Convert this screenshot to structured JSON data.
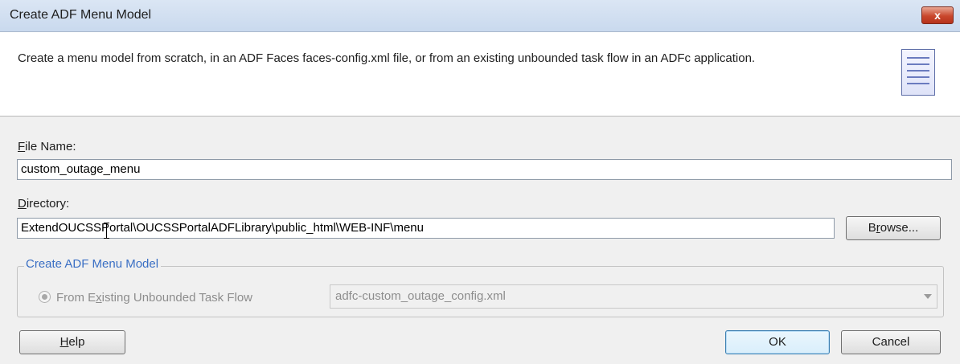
{
  "window": {
    "title": "Create ADF Menu Model",
    "close_glyph": "x"
  },
  "header": {
    "description": "Create a menu model from scratch, in an ADF Faces faces-config.xml file, or from an existing unbounded task flow in an ADFc application.",
    "icon": "document-icon"
  },
  "file_name": {
    "label_mnemonic": "F",
    "label_rest": "ile Name:",
    "value": "custom_outage_menu"
  },
  "directory": {
    "label_mnemonic": "D",
    "label_rest": "irectory:",
    "value": "ExtendOUCSSPortal\\OUCSSPortalADFLibrary\\public_html\\WEB-INF\\menu"
  },
  "browse": {
    "pre": "B",
    "mnemonic": "r",
    "post": "owse..."
  },
  "group": {
    "title": "Create ADF Menu Model",
    "radio": {
      "pre": "From E",
      "mnemonic": "x",
      "post": "isting Unbounded Task Flow",
      "selected": true,
      "enabled": false
    },
    "taskflow_select": {
      "value": "adfc-custom_outage_config.xml",
      "enabled": false
    }
  },
  "buttons": {
    "help": {
      "mnemonic": "H",
      "rest": "elp"
    },
    "ok": "OK",
    "cancel": "Cancel"
  }
}
